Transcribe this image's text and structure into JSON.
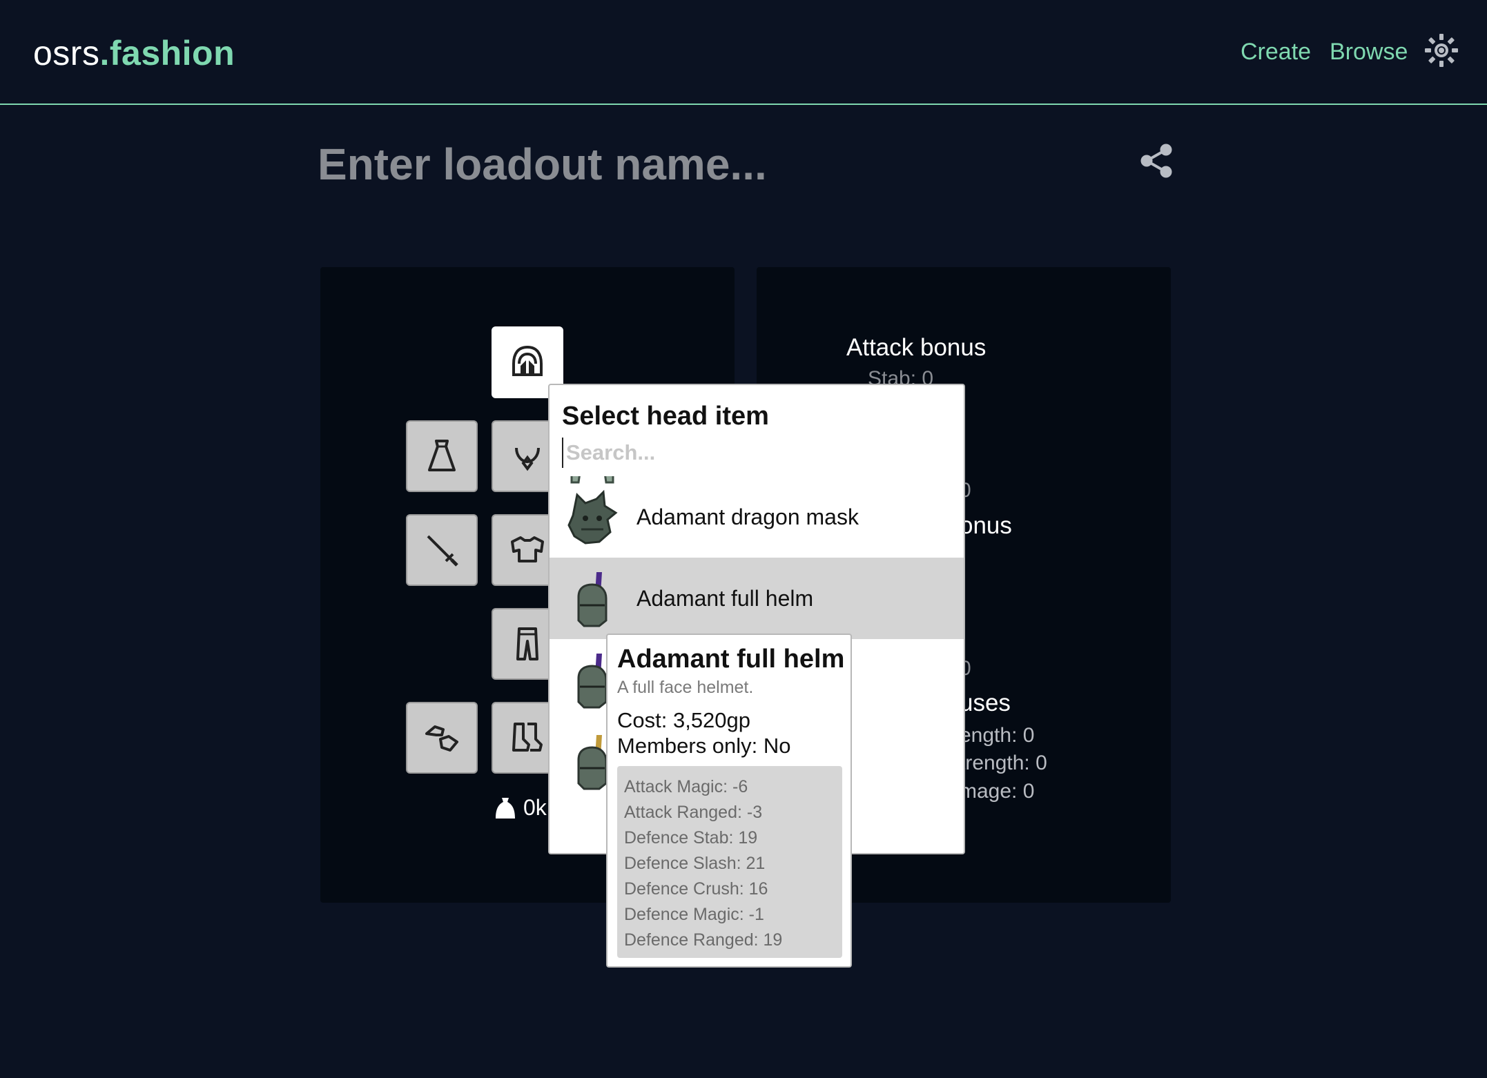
{
  "header": {
    "logo_prefix": "osrs",
    "logo_suffix": ".fashion",
    "nav": {
      "create": "Create",
      "browse": "Browse"
    },
    "theme_icon": "sun-icon"
  },
  "loadout": {
    "name_placeholder": "Enter loadout name...",
    "share_icon": "share-icon"
  },
  "slots": [
    {
      "slot": "head",
      "icon": "helmet-icon",
      "selected": true
    },
    {
      "slot": "cape",
      "icon": "cape-icon"
    },
    {
      "slot": "neck",
      "icon": "amulet-icon"
    },
    {
      "slot": "weapon",
      "icon": "sword-icon"
    },
    {
      "slot": "body",
      "icon": "platebody-icon"
    },
    {
      "slot": "legs",
      "icon": "platelegs-icon"
    },
    {
      "slot": "hands",
      "icon": "gloves-icon"
    },
    {
      "slot": "feet",
      "icon": "boots-icon"
    }
  ],
  "cost": {
    "icon": "money-bag-icon",
    "value": "0k"
  },
  "stats": {
    "attack_title": "Attack bonus",
    "attack_stab": "Stab: 0",
    "defence_partial_value": "0",
    "defence_title_partial": "onus",
    "other_partial_value": "0",
    "other_title_partial": "uses",
    "melee_strength_partial": "ength: 0",
    "ranged_strength_partial": "trength: 0",
    "magic_damage_partial": "mage: 0"
  },
  "modal": {
    "title": "Select head item",
    "search_placeholder": "Search...",
    "items": [
      {
        "name": "",
        "icon": "adamant-helm-icon"
      },
      {
        "name": "Adamant dragon mask",
        "icon": "dragon-mask-icon"
      },
      {
        "name": "Adamant full helm",
        "icon": "adamant-full-helm-icon",
        "hovered": true
      },
      {
        "name": "",
        "icon": "adamant-full-helm-icon"
      },
      {
        "name": "",
        "icon": "adamant-full-helm-gold-icon"
      }
    ]
  },
  "tooltip": {
    "title": "Adamant full helm",
    "examine": "A full face helmet.",
    "cost": "Cost: 3,520gp",
    "members": "Members only: No",
    "stats": [
      "Attack Magic: -6",
      "Attack Ranged: -3",
      "Defence Stab: 19",
      "Defence Slash: 21",
      "Defence Crush: 16",
      "Defence Magic: -1",
      "Defence Ranged: 19"
    ]
  }
}
